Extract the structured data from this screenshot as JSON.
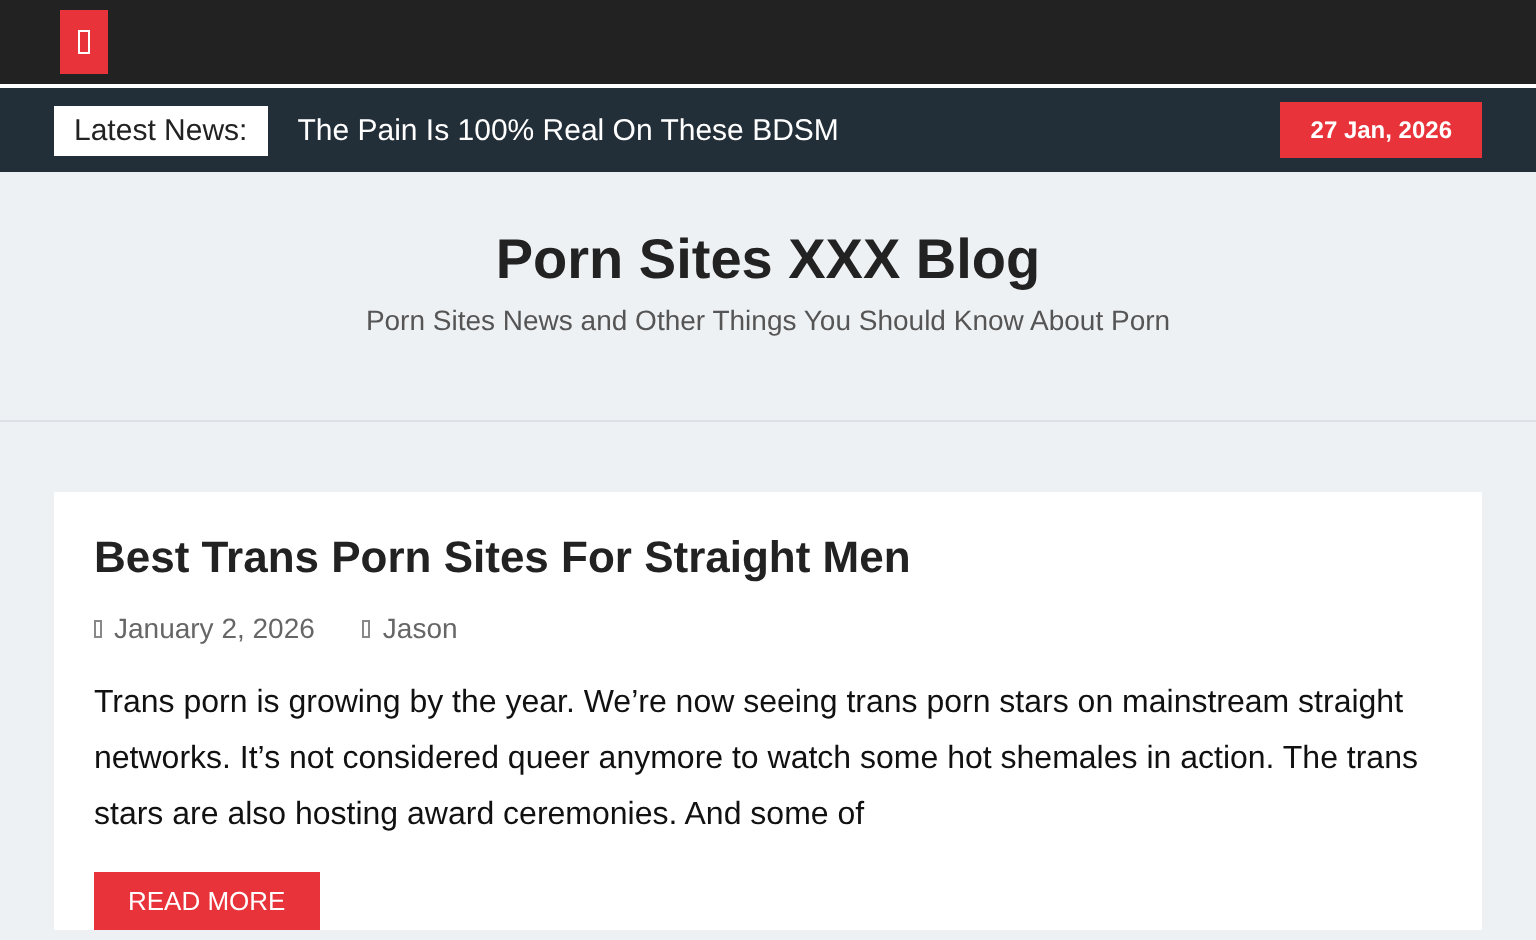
{
  "news_bar": {
    "label": "Latest News:",
    "headline": "The Pain Is 100% Real On These BDSM",
    "date": "27 Jan, 2026"
  },
  "site": {
    "title": "Porn Sites XXX Blog",
    "tagline": "Porn Sites News and Other Things You Should Know About Porn"
  },
  "posts": [
    {
      "title": "Best Trans Porn Sites For Straight Men",
      "date": "January 2, 2026",
      "author": "Jason",
      "excerpt": "Trans porn is growing by the year. We’re now seeing trans porn stars on mainstream straight networks. It’s not considered queer anymore to watch some hot shemales in action. The trans stars are also hosting award ceremonies. And some of",
      "button": "READ MORE"
    }
  ]
}
